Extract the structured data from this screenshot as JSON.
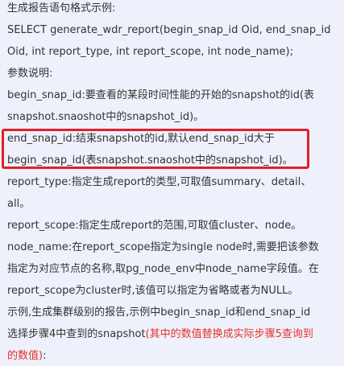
{
  "paragraphs": [
    {
      "id": "intro",
      "text": "生成报告语句格式示例:"
    },
    {
      "id": "sql-1",
      "text": "SELECT generate_wdr_report(begin_snap_id Oid, end_snap_id"
    },
    {
      "id": "sql-2",
      "text": "Oid, int report_type, int report_scope, int node_name);"
    },
    {
      "id": "params",
      "text": "参数说明:"
    },
    {
      "id": "begin-1",
      "text": "begin_snap_id:要查看的某段时间性能的开始的snapshot的id(表"
    },
    {
      "id": "begin-2",
      "text": "snapshot.snaoshot中的snapshot_id)。"
    },
    {
      "id": "end-1",
      "text": "end_snap_id:结束snapshot的id,默认end_snap_id大于"
    },
    {
      "id": "end-2",
      "text": "begin_snap_id(表snapshot.snaoshot中的snapshot_id)。"
    },
    {
      "id": "type-1",
      "text": "report_type:指定生成report的类型,可取值summary、detail、"
    },
    {
      "id": "type-2",
      "text": "all。"
    },
    {
      "id": "scope",
      "text": "report_scope:指定生成report的范围,可取值cluster、node。"
    },
    {
      "id": "node-1",
      "text": "node_name:在report_scope指定为single node时,需要把该参数"
    },
    {
      "id": "node-2",
      "text": "指定为对应节点的名称,取pg_node_env中node_name字段值。在"
    },
    {
      "id": "node-3",
      "text": "report_scope为cluster时,该值可以指定为省略或者为NULL。"
    },
    {
      "id": "example-1",
      "text": "示例,生成集群级别的报告,示例中begin_snap_id和end_snap_id"
    }
  ],
  "last_para": {
    "line1_prefix": "选择步骤4中查到的snapshot",
    "line1_red": "(其中的数值替换成实际步骤5查询到",
    "line2_red": "的数值)",
    "line2_suffix": ":"
  },
  "colors": {
    "text": "#333333",
    "background": "#eef1fb",
    "emphasis": "#e5322d",
    "highlight_border": "#e0202a"
  }
}
